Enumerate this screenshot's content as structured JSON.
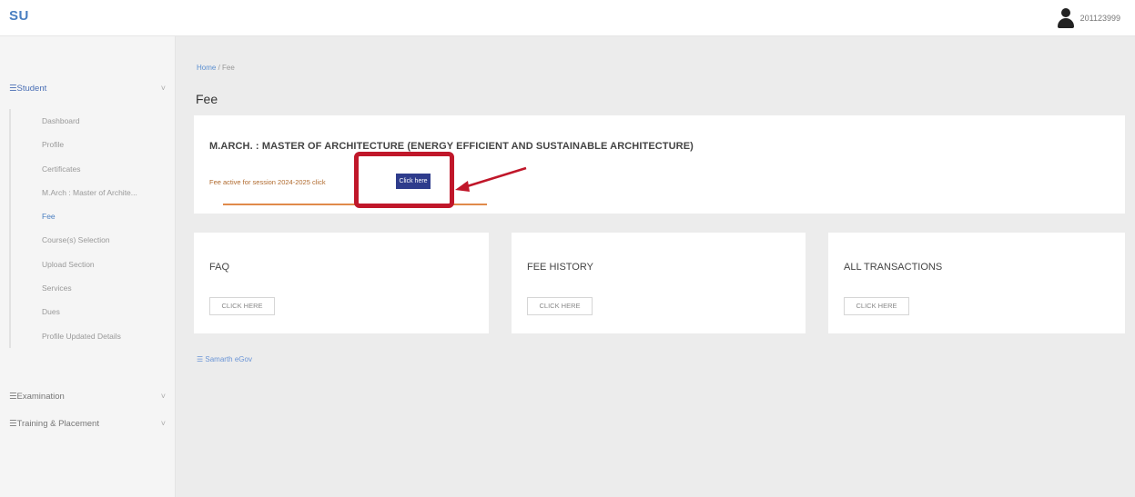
{
  "header": {
    "logo": "SU",
    "user_id": "201123999"
  },
  "sidebar": {
    "groups": [
      {
        "label": "☰Student",
        "chevron": "˅",
        "items": [
          "Dashboard",
          "Profile",
          "Certificates",
          "M.Arch : Master of Archite...",
          "Fee",
          "Course(s) Selection",
          "Upload Section",
          "Services",
          "Dues",
          "Profile Updated Details"
        ]
      },
      {
        "label": "☰Examination",
        "chevron": "˅"
      },
      {
        "label": "☰Training & Placement",
        "chevron": "˅"
      }
    ],
    "current_item": "Fee"
  },
  "breadcrumb": {
    "home": "Home",
    "separator": " / ",
    "current": "Fee"
  },
  "page_title": "Fee",
  "program_card": {
    "title": "M.ARCH. : MASTER OF ARCHITECTURE (ENERGY EFFICIENT AND SUSTAINABLE ARCHITECTURE)",
    "fee_text": "Fee active for session 2024-2025 click",
    "button_label": "Click here"
  },
  "cards": [
    {
      "title": "FAQ",
      "button": "CLICK HERE"
    },
    {
      "title": "FEE HISTORY",
      "button": "CLICK HERE"
    },
    {
      "title": "ALL TRANSACTIONS",
      "button": "CLICK HERE"
    }
  ],
  "footer_link": "☰ Samarth eGov",
  "colors": {
    "accent": "#4a7fc1",
    "button": "#2e3c8c",
    "annotation": "#c0172a"
  }
}
